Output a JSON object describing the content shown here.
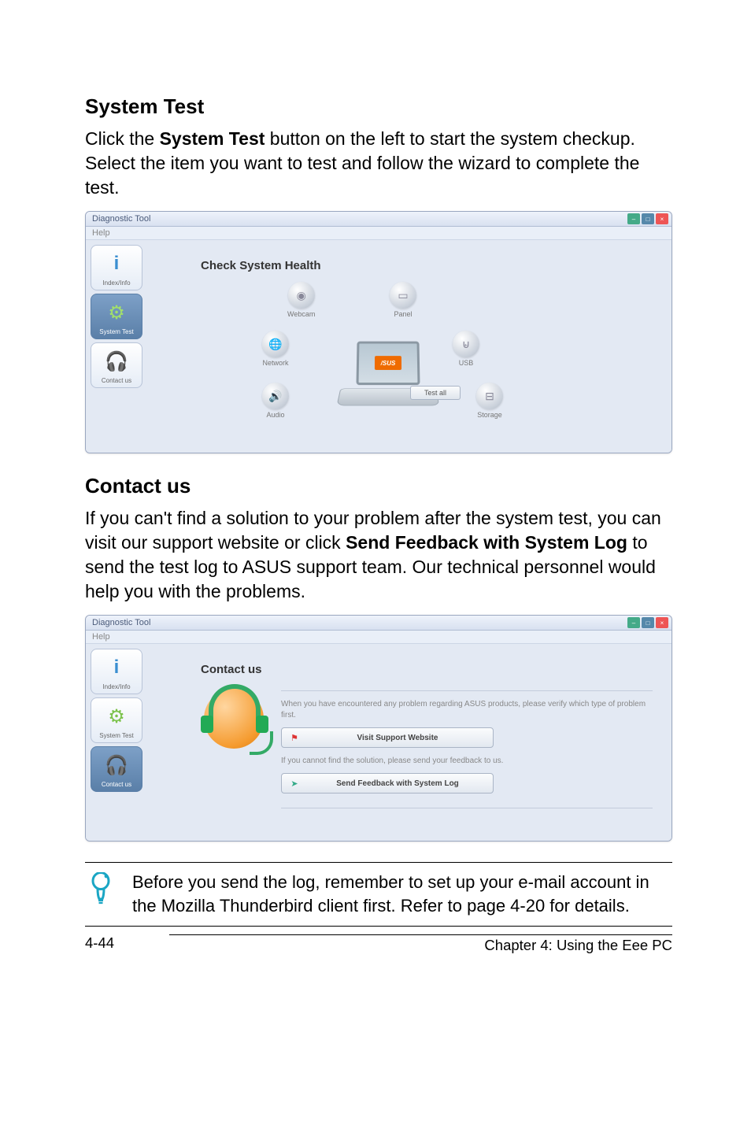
{
  "sections": {
    "system_test": {
      "heading": "System Test",
      "body": "Click the <b>System Test</b> button on the left to start the system checkup. Select the item you want to test and follow the wizard to complete the test."
    },
    "contact_us": {
      "heading": "Contact us",
      "body": "If you can't find a solution to your problem after the system test, you can visit our support website or click <b>Send Feedback with System Log</b> to send the test log to ASUS support team. Our technical personnel would help you with the problems."
    }
  },
  "appwindow": {
    "title": "Diagnostic Tool",
    "menu": "Help"
  },
  "sidebar": {
    "items": [
      {
        "label": "Index/Info"
      },
      {
        "label": "System Test"
      },
      {
        "label": "Contact us"
      }
    ]
  },
  "health_panel": {
    "title": "Check System Health",
    "items": {
      "webcam": "Webcam",
      "panel": "Panel",
      "network": "Network",
      "usb": "USB",
      "audio": "Audio",
      "storage": "Storage"
    },
    "laptop_badge": "/SUS",
    "testall_label": "Test all"
  },
  "contact_panel": {
    "title": "Contact us",
    "note1": "When you have encountered any problem regarding ASUS products, please verify which type of problem first.",
    "btn1": "Visit Support Website",
    "note2": "If you cannot find the solution, please send your feedback to us.",
    "btn2": "Send Feedback with System Log"
  },
  "tip": {
    "text": "Before you send the log, remember to set up your e-mail account in the Mozilla Thunderbird client first. Refer to page 4-20 for details."
  },
  "footer": {
    "page": "4-44",
    "chapter": "Chapter 4: Using the Eee PC"
  }
}
